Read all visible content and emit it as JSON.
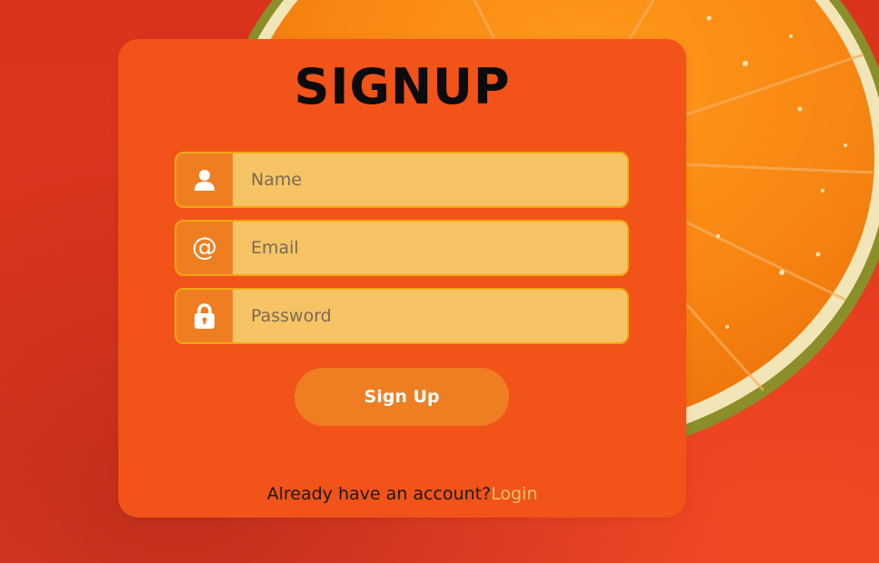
{
  "page": {
    "title": "SIGNUP"
  },
  "form": {
    "fields": [
      {
        "name": "name",
        "placeholder": "Name",
        "icon": "user-icon"
      },
      {
        "name": "email",
        "placeholder": "Email",
        "icon": "at-icon"
      },
      {
        "name": "password",
        "placeholder": "Password",
        "icon": "lock-icon"
      }
    ],
    "at_symbol": "@",
    "submit_label": "Sign Up"
  },
  "footer": {
    "prompt": "Already have an account?",
    "login_label": "Login"
  },
  "colors": {
    "background": "#e23a20",
    "card": "#f15318",
    "input": "#f6c464",
    "input_border": "#f5a414",
    "icon_box": "#ef7e22",
    "button": "#ef7e22",
    "link": "#f9c36a",
    "title": "#0b0b0b"
  }
}
